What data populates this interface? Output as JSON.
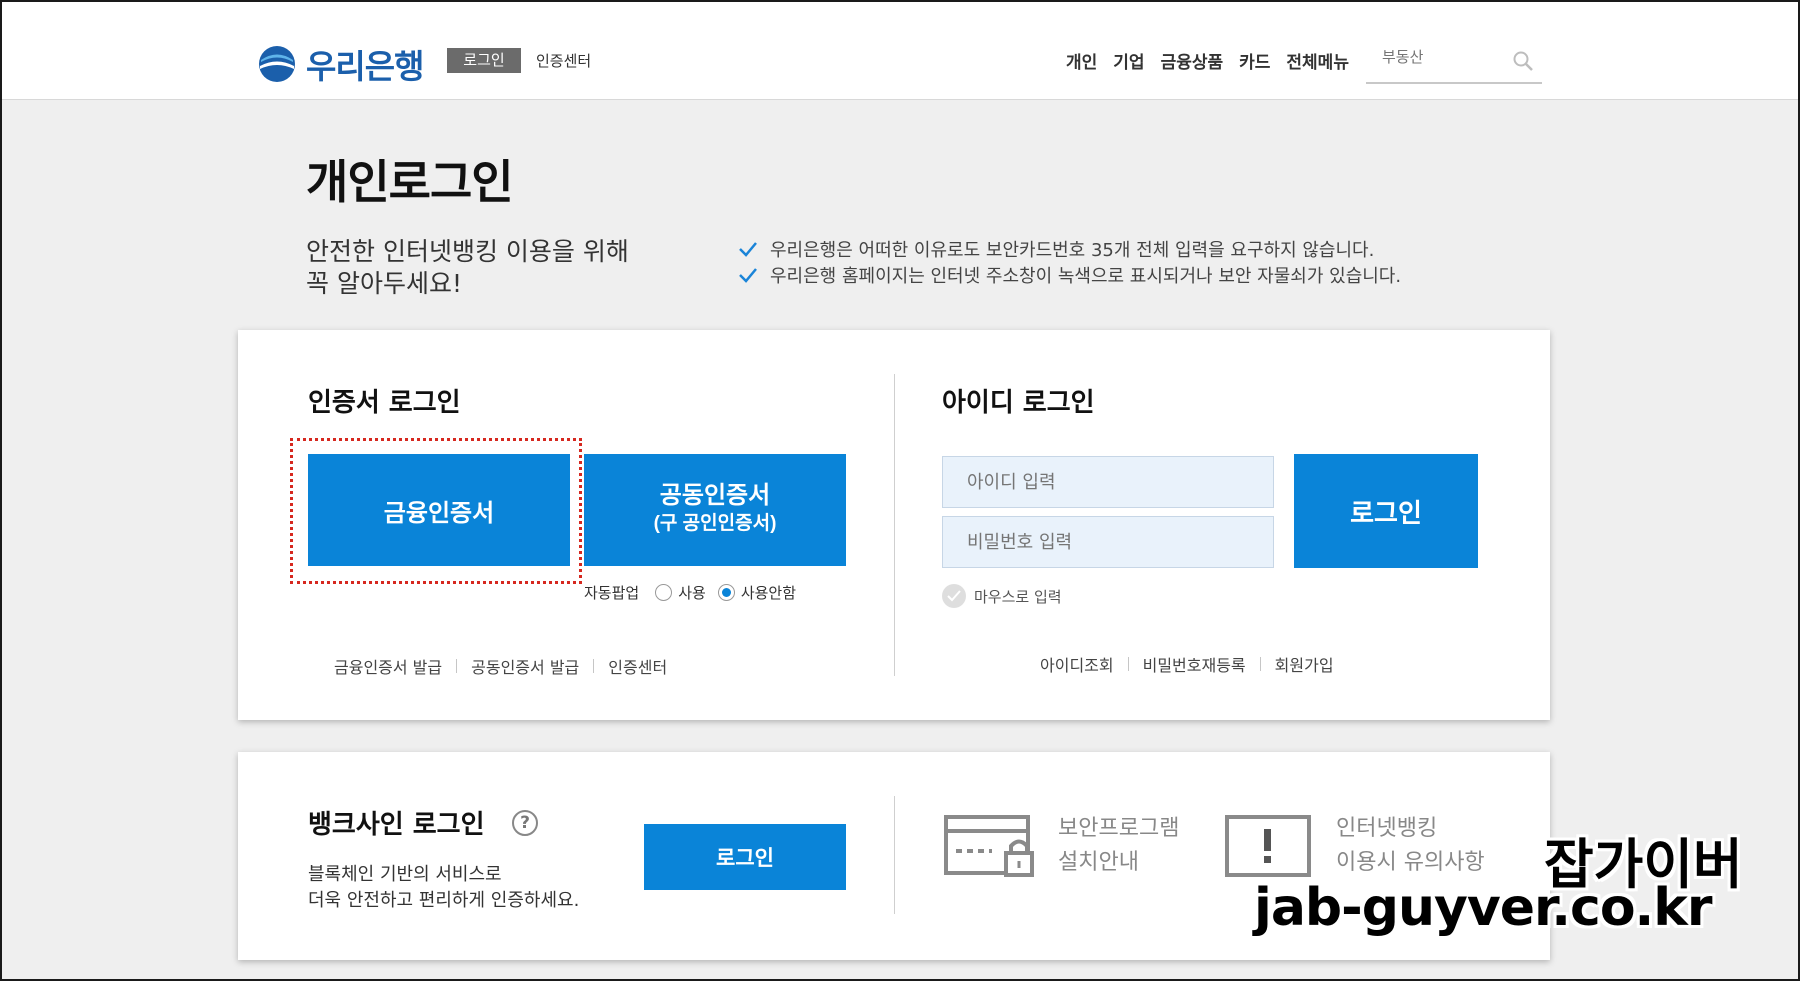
{
  "header": {
    "brand": "우리은행",
    "login_tag": "로그인",
    "cert_center": "인증센터",
    "nav": [
      "개인",
      "기업",
      "금융상품",
      "카드",
      "전체메뉴"
    ],
    "search_placeholder": "부동산"
  },
  "page": {
    "title": "개인로그인",
    "notice_heading_line1": "안전한 인터넷뱅킹 이용을 위해",
    "notice_heading_line2": "꼭 알아두세요!",
    "notices": [
      "우리은행은 어떠한 이유로도 보안카드번호 35개 전체 입력을 요구하지 않습니다.",
      "우리은행 홈페이지는 인터넷 주소창이 녹색으로 표시되거나 보안 자물쇠가 있습니다."
    ]
  },
  "cert_login": {
    "title": "인증서 로그인",
    "financial_cert_button": "금융인증서",
    "joint_cert_button_line1": "공동인증서",
    "joint_cert_button_line2": "(구 공인인증서)",
    "auto_popup_label": "자동팝업",
    "radio_use": "사용",
    "radio_no_use": "사용안함",
    "links": [
      "금융인증서 발급",
      "공동인증서 발급",
      "인증센터"
    ]
  },
  "id_login": {
    "title": "아이디 로그인",
    "id_placeholder": "아이디 입력",
    "pw_placeholder": "비밀번호 입력",
    "login_button": "로그인",
    "mouse_input": "마우스로 입력",
    "links": [
      "아이디조회",
      "비밀번호재등록",
      "회원가입"
    ]
  },
  "banksign": {
    "title": "뱅크사인 로그인",
    "help": "?",
    "desc_line1": "블록체인 기반의 서비스로",
    "desc_line2": "더욱 안전하고 편리하게 인증하세요.",
    "login_button": "로그인",
    "security_line1": "보안프로그램",
    "security_line2": "설치안내",
    "caution_line1": "인터넷뱅킹",
    "caution_line2": "이용시 유의사항"
  },
  "watermark": {
    "ko": "잡가이버",
    "en": "jab-guyver.co.kr"
  },
  "colors": {
    "brand_blue": "#0a84d8",
    "logo_blue": "#1b5fab",
    "highlight_red": "#d6281f"
  }
}
